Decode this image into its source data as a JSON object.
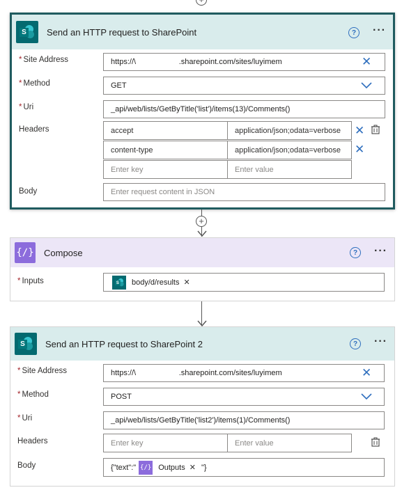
{
  "card1": {
    "title": "Send an HTTP request to SharePoint",
    "site_label": "Site Address",
    "site_value": "https://\\                            .sharepoint.com/sites/luyimem",
    "method_label": "Method",
    "method_value": "GET",
    "uri_label": "Uri",
    "uri_value": "_api/web/lists/GetByTitle('list')/items(13)/Comments()",
    "headers_label": "Headers",
    "headers": [
      {
        "key": "accept",
        "value": "application/json;odata=verbose"
      },
      {
        "key": "content-type",
        "value": "application/json;odata=verbose"
      }
    ],
    "key_placeholder": "Enter key",
    "value_placeholder": "Enter value",
    "body_label": "Body",
    "body_placeholder": "Enter request content in JSON"
  },
  "compose": {
    "title": "Compose",
    "inputs_label": "Inputs",
    "token_label": "body/d/results"
  },
  "card2": {
    "title": "Send an HTTP request to SharePoint 2",
    "site_label": "Site Address",
    "site_value": "https://\\                            .sharepoint.com/sites/luyimem",
    "method_label": "Method",
    "method_value": "POST",
    "uri_label": "Uri",
    "uri_value": "_api/web/lists/GetByTitle('list2')/items(1)/Comments()",
    "headers_label": "Headers",
    "key_placeholder": "Enter key",
    "value_placeholder": "Enter value",
    "body_label": "Body",
    "body_prefix": "{\"text\":\"",
    "body_token": "Outputs",
    "body_suffix": "\"}"
  },
  "common": {
    "required_mark": "*",
    "help_glyph": "?",
    "more_glyph": "···",
    "clear_glyph": "✕",
    "plus_glyph": "+",
    "sp_letter": "S",
    "compose_glyph": "{∕}"
  },
  "colors": {
    "sharepoint_header": "#d9ecec",
    "compose_header": "#ece6f7",
    "sharepoint_brand": "#046a70",
    "compose_brand": "#8c6cdc",
    "accent_blue": "#2f6fbe",
    "selected_border": "#1f5b5f",
    "required_red": "#a4262c"
  },
  "icons": [
    "sharepoint-logo-icon",
    "compose-icon",
    "help-icon",
    "more-icon",
    "clear-icon",
    "chevron-down-icon",
    "trash-icon",
    "add-step-icon",
    "arrow-down-icon"
  ]
}
